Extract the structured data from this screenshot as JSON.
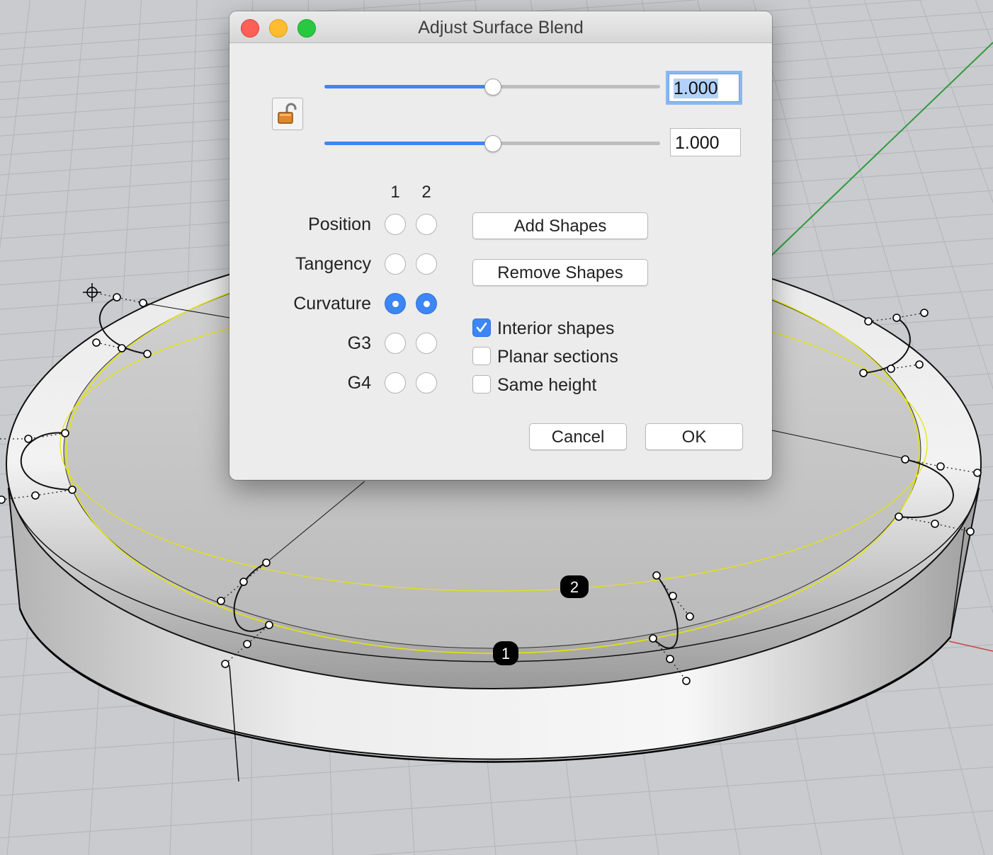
{
  "dialog": {
    "title": "Adjust Surface Blend",
    "sliders": [
      {
        "value": 0.5,
        "field": "1.000",
        "focused": true
      },
      {
        "value": 0.5,
        "field": "1.000",
        "focused": false
      }
    ],
    "columns": [
      "1",
      "2"
    ],
    "continuity": [
      {
        "label": "Position",
        "side1": false,
        "side2": false
      },
      {
        "label": "Tangency",
        "side1": false,
        "side2": false
      },
      {
        "label": "Curvature",
        "side1": true,
        "side2": true
      },
      {
        "label": "G3",
        "side1": false,
        "side2": false
      },
      {
        "label": "G4",
        "side1": false,
        "side2": false
      }
    ],
    "buttons": {
      "add_shapes": "Add Shapes",
      "remove_shapes": "Remove Shapes",
      "cancel": "Cancel",
      "ok": "OK"
    },
    "options": [
      {
        "label": "Interior shapes",
        "checked": true
      },
      {
        "label": "Planar sections",
        "checked": false
      },
      {
        "label": "Same height",
        "checked": false
      }
    ]
  },
  "viewport": {
    "edge_markers": [
      "1",
      "2"
    ]
  },
  "colors": {
    "accent": "#3c86f5",
    "grid": "#b1b4b9",
    "background": "#c9cbcf",
    "blend_edge": "#e6e600"
  }
}
